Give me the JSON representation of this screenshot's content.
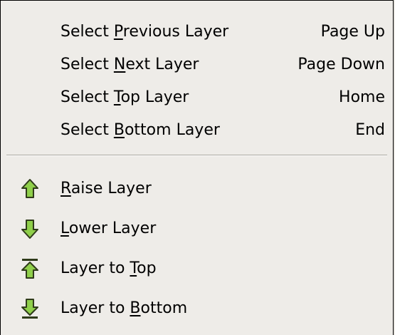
{
  "menu": {
    "select_items": [
      {
        "pre": "Select ",
        "mn": "P",
        "post": "revious Layer",
        "accel": "Page Up"
      },
      {
        "pre": "Select ",
        "mn": "N",
        "post": "ext Layer",
        "accel": "Page Down"
      },
      {
        "pre": "Select ",
        "mn": "T",
        "post": "op Layer",
        "accel": "Home"
      },
      {
        "pre": "Select ",
        "mn": "B",
        "post": "ottom Layer",
        "accel": "End"
      }
    ],
    "stack_items": [
      {
        "pre": "",
        "mn": "R",
        "post": "aise Layer",
        "icon": "raise-layer-icon"
      },
      {
        "pre": "",
        "mn": "L",
        "post": "ower Layer",
        "icon": "lower-layer-icon"
      },
      {
        "pre": "Layer to ",
        "mn": "T",
        "post": "op",
        "icon": "layer-to-top-icon"
      },
      {
        "pre": "Layer to ",
        "mn": "B",
        "post": "ottom",
        "icon": "layer-to-bottom-icon"
      }
    ],
    "colors": {
      "background": "#eeece8",
      "icon_fill": "#8fcf4a",
      "icon_stroke": "#2f3b1a"
    }
  }
}
